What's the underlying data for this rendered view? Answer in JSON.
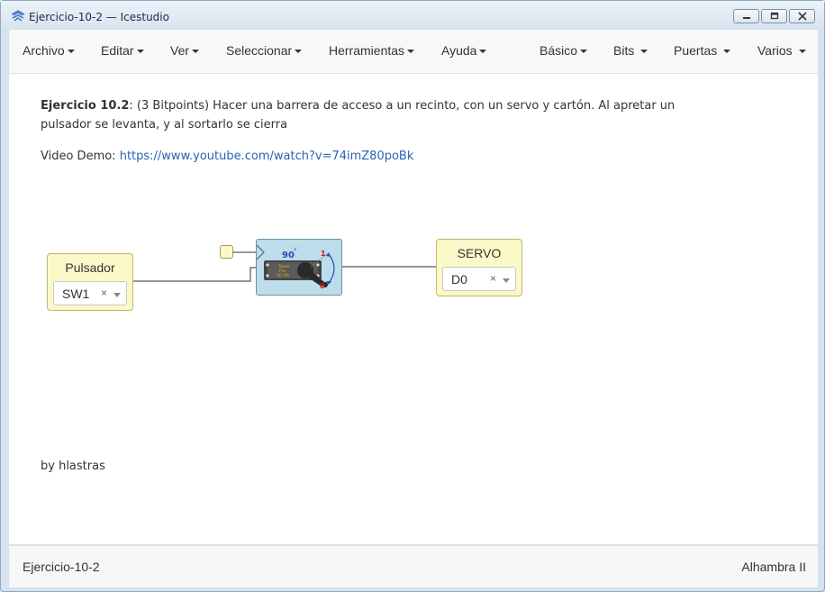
{
  "window": {
    "title": "Ejercicio-10-2 — Icestudio"
  },
  "menubar": {
    "left": [
      "Archivo",
      "Editar",
      "Ver",
      "Seleccionar",
      "Herramientas",
      "Ayuda"
    ],
    "right": [
      "Básico",
      "Bits",
      "Puertas",
      "Varios"
    ]
  },
  "info": {
    "title_bold": "Ejercicio 10.2",
    "description": ": (3 Bitpoints) Hacer una barrera de acceso a un recinto, con un servo y cartón. Al apretar un pulsador se levanta, y al sortarlo se cierra",
    "video_label": "Video Demo: ",
    "video_link": "https://www.youtube.com/watch?v=74imZ80poBk",
    "author": "by hlastras"
  },
  "blocks": {
    "input": {
      "title": "Pulsador",
      "value": "SW1",
      "clear": "×"
    },
    "servo": {
      "angle_label": "90",
      "degree_sign": "°",
      "max_label": "1",
      "min_label": "0",
      "brand_line1": "Tower",
      "brand_line2": "Pro",
      "brand_line3": "SG-90"
    },
    "output": {
      "title": "SERVO",
      "value": "D0",
      "clear": "×"
    }
  },
  "statusbar": {
    "project": "Ejercicio-10-2",
    "board": "Alhambra II"
  },
  "colors": {
    "link": "#2a62b4",
    "block_fill": "#fcf9c9",
    "servo_fill": "#bcdde9",
    "wire": "#777777"
  }
}
